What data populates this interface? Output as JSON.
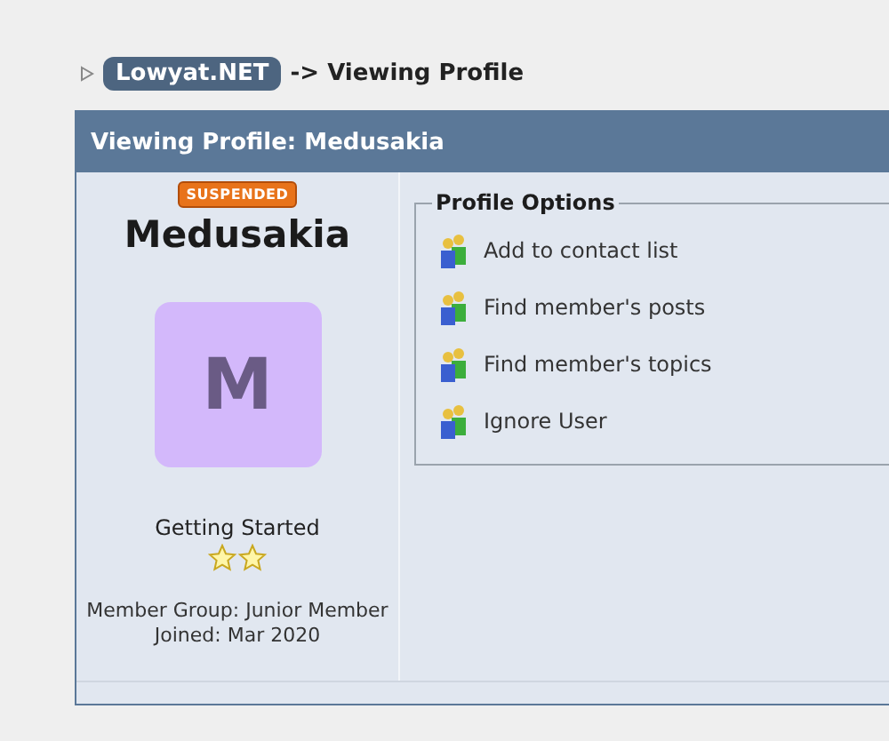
{
  "breadcrumb": {
    "site": "Lowyat.NET",
    "trail": "-> Viewing Profile"
  },
  "panel": {
    "title": "Viewing Profile: Medusakia"
  },
  "profile": {
    "badge": "SUSPENDED",
    "name": "Medusakia",
    "avatar_letter": "M",
    "rank": "Getting Started",
    "group": "Member Group: Junior Member",
    "joined": "Joined: Mar 2020"
  },
  "options": {
    "title": "Profile Options",
    "items": [
      {
        "label": "Add to contact list"
      },
      {
        "label": "Find member's posts"
      },
      {
        "label": "Find member's topics"
      },
      {
        "label": "Ignore User"
      }
    ]
  }
}
